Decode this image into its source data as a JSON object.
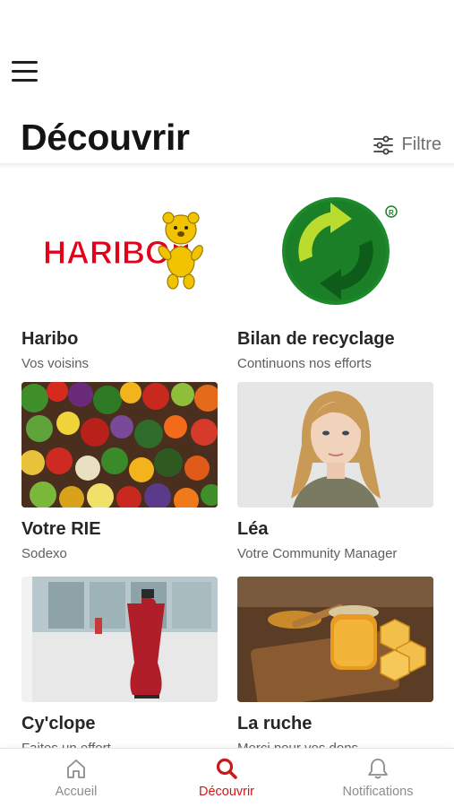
{
  "header": {
    "title": "Découvrir",
    "filter_label": "Filtre"
  },
  "cards": [
    {
      "name": "Haribo",
      "subtitle": "Vos voisins",
      "logo_text": "HARIBO"
    },
    {
      "name": "Bilan de recyclage",
      "subtitle": "Continuons nos efforts"
    },
    {
      "name": "Votre RIE",
      "subtitle": "Sodexo"
    },
    {
      "name": "Léa",
      "subtitle": "Votre Community Manager"
    },
    {
      "name": "Cy'clope",
      "subtitle": "Faites un effort"
    },
    {
      "name": "La ruche",
      "subtitle": "Merci pour vos dons"
    }
  ],
  "tabs": [
    {
      "label": "Accueil",
      "icon": "home-icon",
      "active": false
    },
    {
      "label": "Découvrir",
      "icon": "search-icon",
      "active": true
    },
    {
      "label": "Notifications",
      "icon": "bell-icon",
      "active": false
    }
  ],
  "colors": {
    "accent": "#c91a1a",
    "inactive": "#8c8c8c",
    "haribo_red": "#e2001a",
    "recycle_green": "#1d8a2a"
  }
}
